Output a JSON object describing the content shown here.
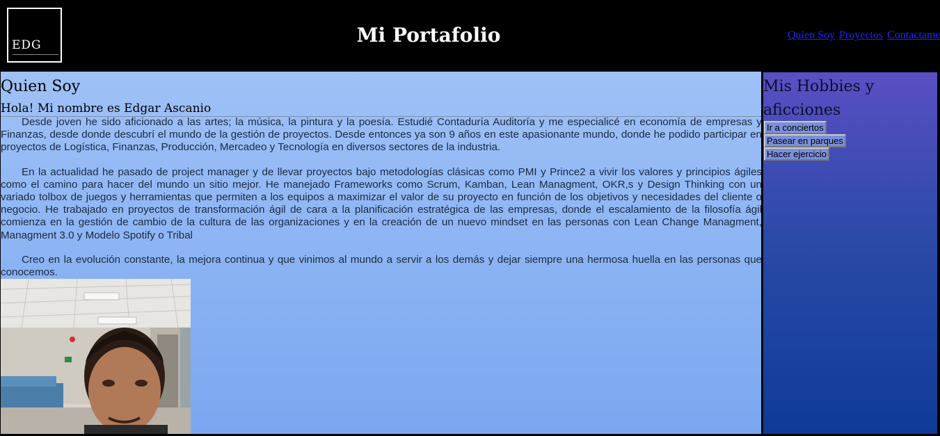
{
  "header": {
    "logo_text": "EDG",
    "title": "Mi Portafolio",
    "nav": [
      "Quien Soy",
      "Proyectos",
      "Contactame"
    ]
  },
  "main": {
    "heading": "Quien Soy",
    "subheading": "Hola! Mi nombre es Edgar Ascanio",
    "paragraphs": [
      "Desde joven he sido aficionado a las artes; la música, la pintura y la poesía. Estudié Contaduría Auditoría y me especialicé en economía de empresas y Finanzas, desde donde descubrí el mundo de la gestión de proyectos. Desde entonces ya son 9 años en este apasionante mundo, donde he podido participar en proyectos de Logística, Finanzas, Producción, Mercadeo y Tecnología en diversos sectores de la industria.",
      "En la actualidad he pasado de project manager y de llevar proyectos bajo metodologías clásicas como PMI y Prince2 a vivir los valores y principios ágiles como el camino para hacer del mundo un sitio mejor. He manejado Frameworks como Scrum, Kamban, Lean Managment, OKR,s y Design Thinking con un variado tolbox de juegos y herramientas que permiten a los equipos a maximizar el valor de su proyecto en función de los objetivos y necesidades del cliente o negocio. He trabajado en proyectos de transformación ágil de cara a la planificación estratégica de las empresas, donde el escalamiento de la filosofía ágil comienza en la gestión de cambio de la cultura de las organizaciones y en la creación de un nuevo mindset en las personas con Lean Change Managment, Managment 3.0 y Modelo Spotify o Tribal",
      "Creo en la evolución constante, la mejora continua y que vinimos al mundo a servir a los demás y dejar siempre una hermosa huella en las personas que conocemos."
    ]
  },
  "aside": {
    "heading": "Mis Hobbies y aficciones",
    "hobbies": [
      "Ir a conciertos",
      "Pasear en parques",
      "Hacer ejercicio"
    ]
  },
  "colors": {
    "main_bg_top": "#9ec1f7",
    "aside_bg_top": "#5a4fc4",
    "aside_bg_bottom": "#0e3b96",
    "link": "#2323ff"
  }
}
